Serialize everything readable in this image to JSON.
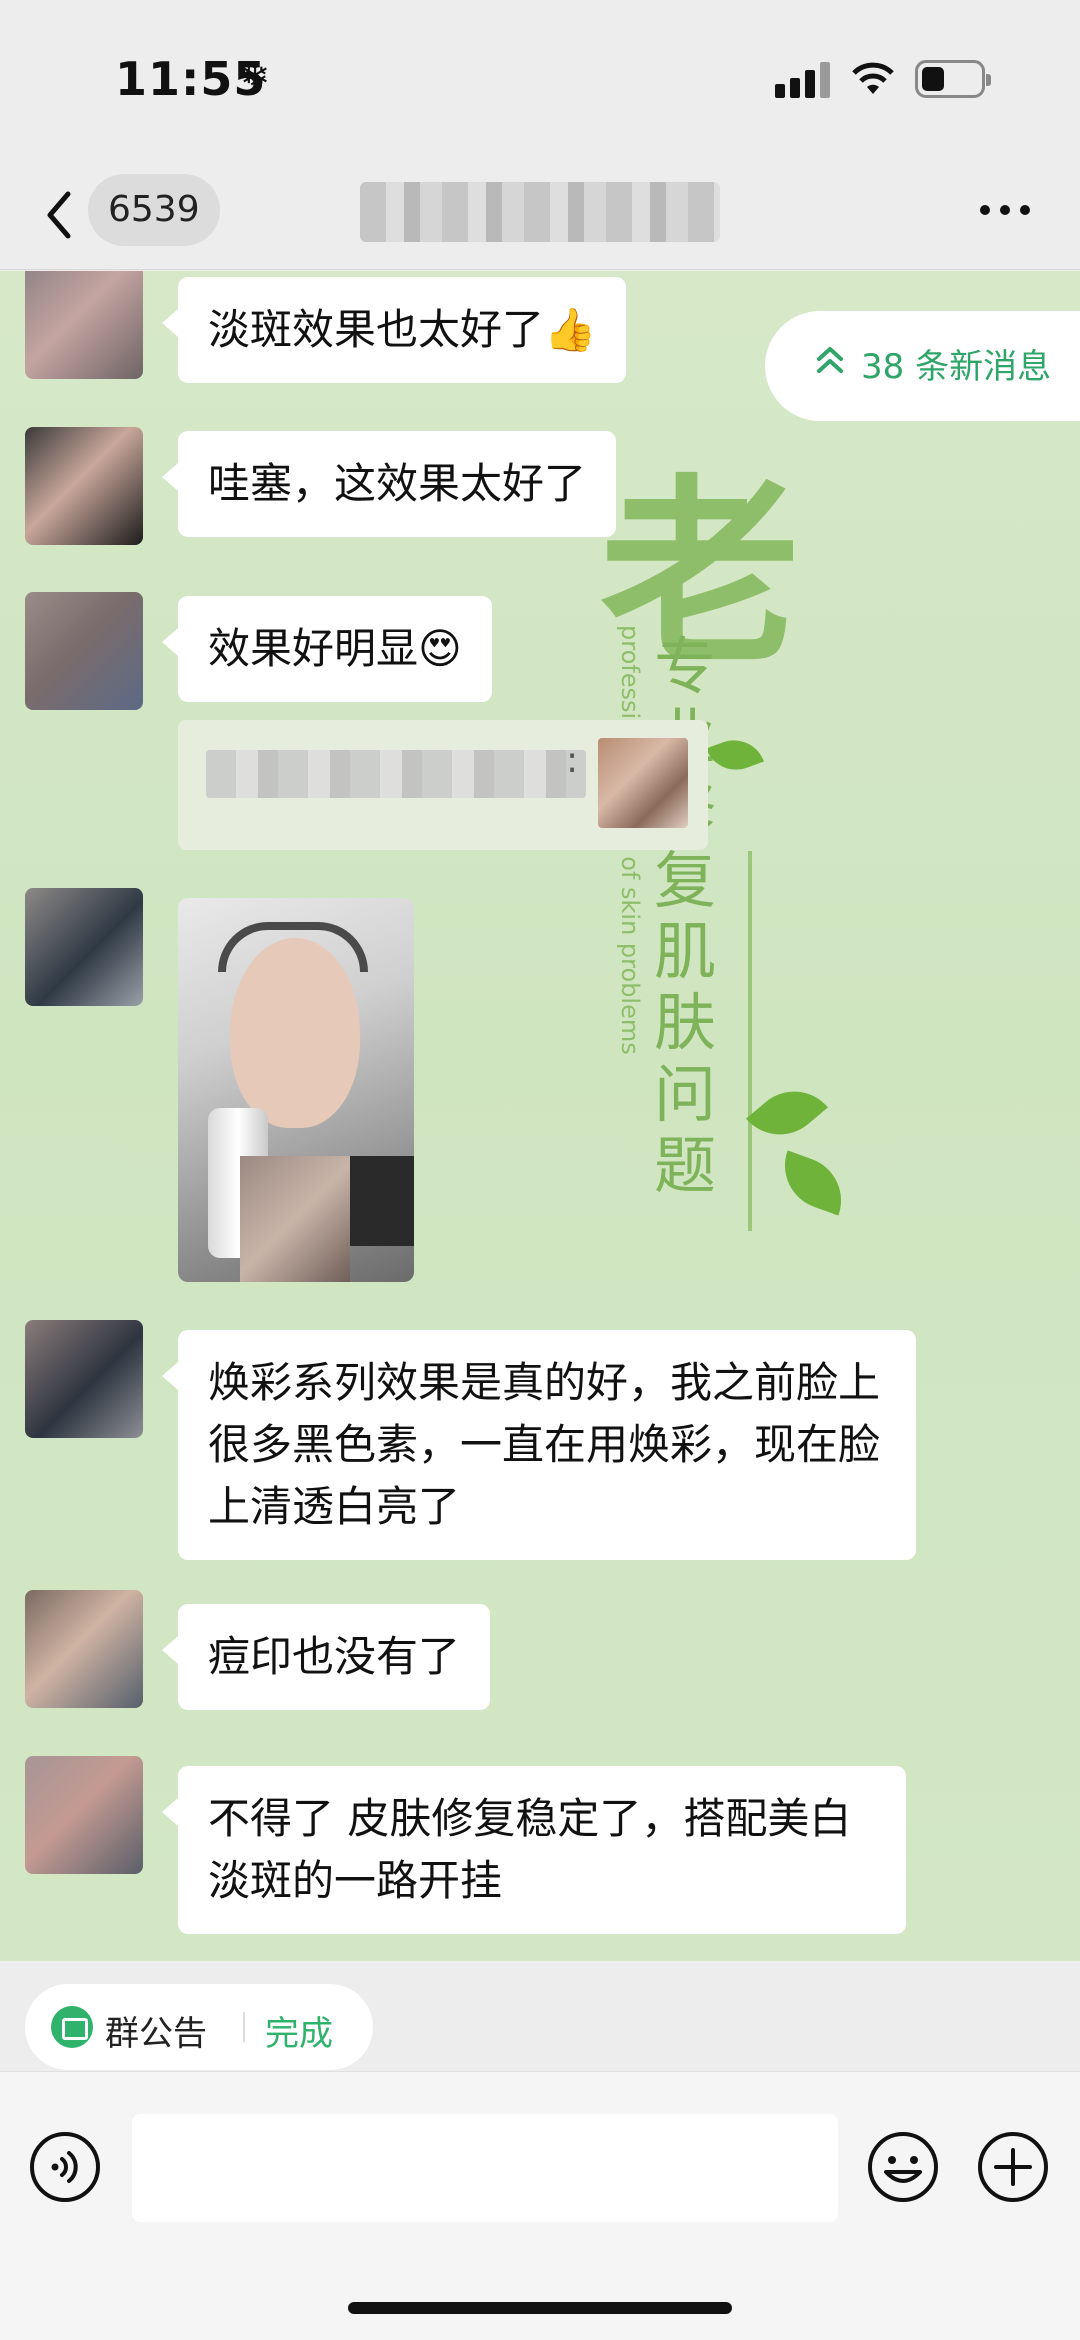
{
  "status_bar": {
    "time": "11:55",
    "weather_glyph": "❄"
  },
  "nav": {
    "unread_count": "6539",
    "title_obscured": true
  },
  "new_messages": {
    "label": "38 条新消息",
    "icon": "double-chevron-up-icon"
  },
  "wallpaper": {
    "big_char": "老",
    "vertical_text": "专业修复肌肤问题",
    "english_text": "professional repair of skin problems"
  },
  "messages": [
    {
      "type": "text",
      "text": "淡斑效果也太好了👍"
    },
    {
      "type": "text",
      "text": "哇塞，这效果太好了"
    },
    {
      "type": "text",
      "text": "效果好明显😍"
    },
    {
      "type": "quote",
      "sender_obscured": true,
      "separator": ":"
    },
    {
      "type": "image"
    },
    {
      "type": "text",
      "text": "焕彩系列效果是真的好，我之前脸上很多黑色素，一直在用焕彩，现在脸上清透白亮了"
    },
    {
      "type": "text",
      "text": "痘印也没有了"
    },
    {
      "type": "text",
      "text": "不得了 皮肤修复稳定了，搭配美白淡斑的一路开挂"
    }
  ],
  "announcement": {
    "label": "群公告",
    "done": "完成"
  },
  "input": {
    "placeholder": "",
    "value": ""
  },
  "colors": {
    "accent": "#2fb26b",
    "chat_bg": "#d3e7c5",
    "bubble": "#ffffff"
  }
}
